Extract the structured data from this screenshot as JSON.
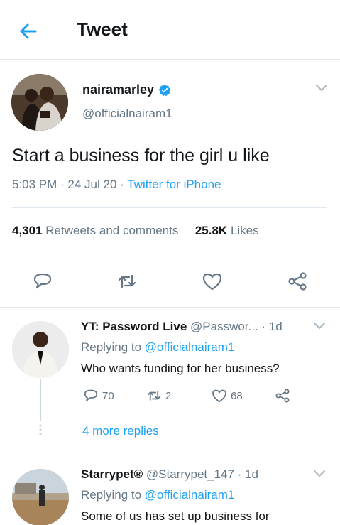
{
  "header": {
    "title": "Tweet",
    "back_icon": "arrow-left-icon"
  },
  "tweet": {
    "author_name": "nairamarley",
    "verified": true,
    "handle": "@officialnairam1",
    "text": "Start a business for the girl u like",
    "time": "5:03 PM · 24 Jul 20 · ",
    "source": "Twitter for iPhone",
    "retweets_count": "4,301",
    "retweets_label": "Retweets and comments",
    "likes_count": "25.8K",
    "likes_label": "Likes"
  },
  "replies": [
    {
      "name": "YT: Password Live",
      "handle": "@Passwor...",
      "age": " · 1d",
      "replying_label": "Replying to ",
      "replying_to": "@officialnairam1",
      "text": "Who wants funding for her business?",
      "reply_count": "70",
      "retweet_count": "2",
      "like_count": "68",
      "more_replies": "4 more replies"
    },
    {
      "name": "Starrypet®",
      "handle": "@Starrypet_147",
      "age": " · 1d",
      "replying_label": "Replying to ",
      "replying_to": "@officialnairam1",
      "text": "Some of us has set up business for"
    }
  ],
  "colors": {
    "accent": "#1da1f2",
    "muted": "#657786",
    "text": "#14171a",
    "divider": "#e1e8ed"
  }
}
